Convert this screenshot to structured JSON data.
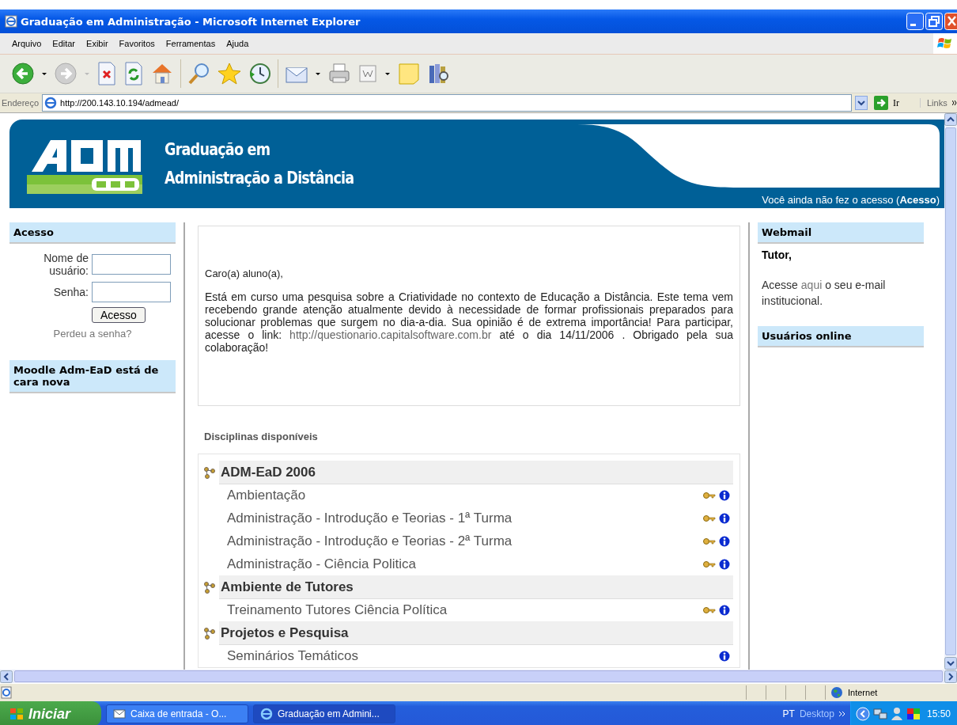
{
  "window": {
    "title": "Graduação em Administração - Microsoft Internet Explorer"
  },
  "menu": [
    "Arquivo",
    "Editar",
    "Exibir",
    "Favoritos",
    "Ferramentas",
    "Ajuda"
  ],
  "address_bar": {
    "label": "Endereço",
    "url": "http://200.143.10.194/admead/",
    "go": "Ir",
    "links": "Links"
  },
  "banner": {
    "title_lines": [
      "Graduação em",
      "Administração a Distância"
    ],
    "notice": {
      "text_before": "Você ainda não fez o acesso (",
      "link": "Acesso",
      "text_after": ")"
    }
  },
  "left_blocks": [
    {
      "kind": "login",
      "header": "Acesso",
      "fields": [
        {
          "label": "Nome de usuário:"
        },
        {
          "label": "Senha:"
        }
      ],
      "button": "Acesso",
      "link": "Perdeu a senha?"
    },
    {
      "kind": "header_only",
      "header": "Moodle Adm-EaD está de cara nova"
    }
  ],
  "message": {
    "greeting": "Caro(a) aluno(a),",
    "text_before": "Está em curso uma pesquisa sobre a Criatividade no contexto de Educação a Distância. Este tema vem recebendo grande atenção atualmente devido à necessidade de formar profissionais preparados para solucionar problemas que surgem no dia-a-dia. Sua opinião é de extrema importância! Para participar, acesse o link: ",
    "link": "http://questionario.capitalsoftware.com.br",
    "text_after": " até o dia 14/11/2006 . Obrigado pela sua colaboração!"
  },
  "right_blocks": [
    {
      "kind": "webmail",
      "header": "Webmail",
      "greeting": "Tutor,",
      "text_before": "Acesse ",
      "link": "aqui",
      "text_after": " o seu e-mail institucional."
    },
    {
      "kind": "header_only",
      "header": "Usuários online"
    }
  ],
  "courses": {
    "heading": "Disciplinas disponíveis",
    "categories": [
      {
        "name": "ADM-EaD 2006",
        "courses": [
          {
            "name": "Ambientação",
            "enrol_key": true
          },
          {
            "name": "Administração - Introdução e Teorias - 1ª Turma",
            "enrol_key": true
          },
          {
            "name": "Administração - Introdução e Teorias - 2ª Turma",
            "enrol_key": true
          },
          {
            "name": "Administração - Ciência Politica",
            "enrol_key": true
          }
        ]
      },
      {
        "name": "Ambiente de Tutores",
        "courses": [
          {
            "name": "Treinamento Tutores Ciência Política",
            "enrol_key": true
          }
        ]
      },
      {
        "name": "Projetos e Pesquisa",
        "courses": [
          {
            "name": "Seminários Temáticos",
            "enrol_key": false
          }
        ]
      }
    ]
  },
  "status_bar": {
    "zone": "Internet"
  },
  "taskbar": {
    "start": "Iniciar",
    "tasks": [
      {
        "label": "Caixa de entrada - O...",
        "selected": false
      },
      {
        "label": "Graduação em Admini...",
        "selected": true
      }
    ],
    "language": "PT",
    "toolbar": "Desktop",
    "time": "15:50"
  }
}
